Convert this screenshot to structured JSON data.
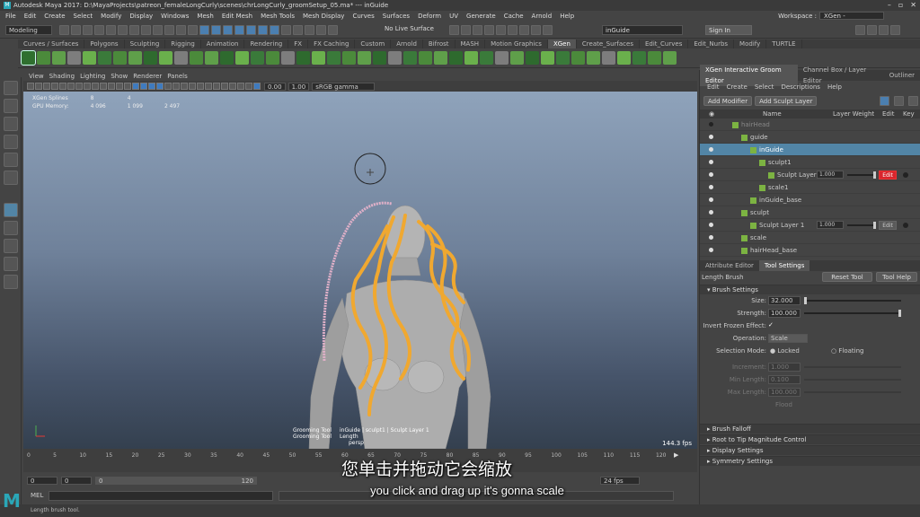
{
  "title_bar": {
    "text": "Autodesk Maya 2017: D:\\MayaProjects\\patreon_femaleLongCurly\\scenes\\chrLongCurly_groomSetup_05.ma* --- inGuide",
    "logo": "M"
  },
  "menu": [
    "File",
    "Edit",
    "Create",
    "Select",
    "Modify",
    "Display",
    "Windows",
    "Mesh",
    "Edit Mesh",
    "Mesh Tools",
    "Mesh Display",
    "Curves",
    "Surfaces",
    "Deform",
    "UV",
    "Generate",
    "Cache",
    "Arnold",
    "Help"
  ],
  "workspace": {
    "label": "Workspace :",
    "value": "XGen - Interactive Groom*"
  },
  "status_line": {
    "mode": "Modeling",
    "no_live": "No Live Surface",
    "object_field": "inGuide",
    "sign_in": "Sign In"
  },
  "shelf_tabs": [
    "Curves / Surfaces",
    "Polygons",
    "Sculpting",
    "Rigging",
    "Animation",
    "Rendering",
    "FX",
    "FX Caching",
    "Custom",
    "Arnold",
    "Bifrost",
    "MASH",
    "Motion Graphics",
    "XGen",
    "Create_Surfaces",
    "Edit_Curves",
    "Edit_Nurbs",
    "Modify",
    "TURTLE"
  ],
  "shelf_active": "XGen",
  "viewport": {
    "menu": [
      "View",
      "Shading",
      "Lighting",
      "Show",
      "Renderer",
      "Panels"
    ],
    "num1": "0.00",
    "num2": "1.00",
    "color_space": "sRGB gamma",
    "hud": [
      {
        "label": "XGen Splines",
        "a": "8",
        "b": "4",
        "c": ""
      },
      {
        "label": "GPU Memory:",
        "a": "4 096",
        "b": "1 099",
        "c": "2 497"
      }
    ],
    "fps": "144.3 fps",
    "groom_hud": {
      "row1_label": "Grooming Tool",
      "row1_value": "inGuide | sculpt1 | Sculpt Layer 1",
      "row2_label": "Grooming Tool",
      "row2_value": "Length",
      "row3": "persp"
    }
  },
  "right_panel": {
    "tabs": [
      "XGen Interactive Groom Editor",
      "Channel Box / Layer Editor",
      "Outliner"
    ],
    "menu": [
      "Edit",
      "Create",
      "Select",
      "Descriptions",
      "Help"
    ],
    "buttons": {
      "add_modifier": "Add Modifier",
      "add_sculpt": "Add Sculpt Layer"
    },
    "columns": {
      "name": "Name",
      "weight": "Layer Weight",
      "edit": "Edit",
      "key": "Key"
    },
    "rows": [
      {
        "name": "hairHead",
        "indent": 36,
        "eye": "off",
        "sel": false,
        "faded": true
      },
      {
        "name": "guide",
        "indent": 46,
        "eye": "on",
        "sel": false
      },
      {
        "name": "inGuide",
        "indent": 56,
        "eye": "on",
        "sel": true
      },
      {
        "name": "sculpt1",
        "indent": 66,
        "eye": "on",
        "sel": false
      },
      {
        "name": "Sculpt Layer 1",
        "indent": 76,
        "eye": "on",
        "sel": false,
        "weight": "1.000",
        "edit": "Edit",
        "edit_active": true
      },
      {
        "name": "scale1",
        "indent": 66,
        "eye": "on",
        "sel": false
      },
      {
        "name": "inGuide_base",
        "indent": 56,
        "eye": "on",
        "sel": false
      },
      {
        "name": "sculpt",
        "indent": 46,
        "eye": "on",
        "sel": false
      },
      {
        "name": "Sculpt Layer 1",
        "indent": 56,
        "eye": "on",
        "sel": false,
        "weight": "1.000",
        "edit": "Edit",
        "edit_active": false
      },
      {
        "name": "scale",
        "indent": 46,
        "eye": "on",
        "sel": false
      },
      {
        "name": "hairHead_base",
        "indent": 46,
        "eye": "on",
        "sel": false
      }
    ]
  },
  "tool_settings": {
    "tabs": [
      "Attribute Editor",
      "Tool Settings"
    ],
    "tool_name": "Length Brush",
    "reset": "Reset Tool",
    "help": "Tool Help",
    "sections": [
      "Brush Settings",
      "Brush Falloff",
      "Root to Tip Magnitude Control",
      "Display Settings",
      "Symmetry Settings"
    ],
    "size_label": "Size:",
    "size": "32.000",
    "strength_label": "Strength:",
    "strength": "100.000",
    "invert_label": "Invert Frozen Effect:",
    "operation_label": "Operation:",
    "operation": "Scale",
    "selection_label": "Selection Mode:",
    "locked": "Locked",
    "floating": "Floating",
    "increment_label": "Increment:",
    "increment": "1.000",
    "minlen_label": "Min Length:",
    "minlen": "0.100",
    "maxlen_label": "Max Length:",
    "maxlen": "100.000",
    "flood": "Flood"
  },
  "timeline": {
    "ticks": [
      "0",
      "5",
      "10",
      "15",
      "20",
      "25",
      "30",
      "35",
      "40",
      "45",
      "50",
      "55",
      "60",
      "65",
      "70",
      "75",
      "80",
      "85",
      "90",
      "95",
      "100",
      "105",
      "110",
      "115",
      "120"
    ],
    "start": "0",
    "current": "0",
    "range_start": "0",
    "range_end": "120",
    "fps": "24 fps"
  },
  "command_line": {
    "label": "MEL"
  },
  "help_line": "Length brush tool.",
  "subtitles": {
    "cn": "您单击并拖动它会缩放",
    "en": "you click and drag up it's gonna scale"
  },
  "colors": {
    "accent": "#5285a6",
    "edit_red": "#d9262d",
    "curve": "#f0a830"
  }
}
